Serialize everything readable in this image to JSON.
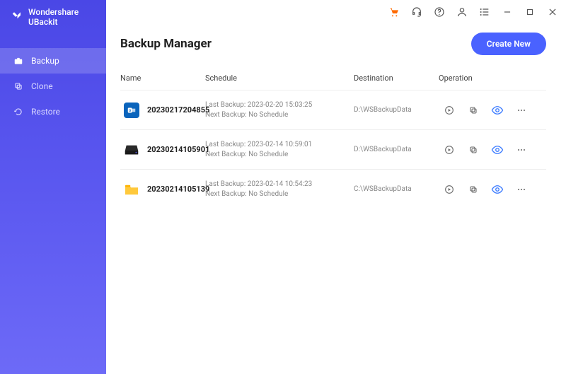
{
  "app_title": "Wondershare UBackit",
  "sidebar": {
    "items": [
      {
        "label": "Backup",
        "active": true
      },
      {
        "label": "Clone",
        "active": false
      },
      {
        "label": "Restore",
        "active": false
      }
    ]
  },
  "page": {
    "title": "Backup Manager",
    "create_button": "Create New"
  },
  "columns": {
    "name": "Name",
    "schedule": "Schedule",
    "destination": "Destination",
    "operation": "Operation"
  },
  "rows": [
    {
      "icon": "outlook",
      "name": "20230217204855",
      "last_backup": "Last Backup: 2023-02-20 15:03:25",
      "next_backup": "Next Backup: No Schedule",
      "destination": "D:\\WSBackupData"
    },
    {
      "icon": "disk",
      "name": "20230214105901",
      "last_backup": "Last Backup: 2023-02-14 10:59:01",
      "next_backup": "Next Backup: No Schedule",
      "destination": "D:\\WSBackupData"
    },
    {
      "icon": "folder",
      "name": "20230214105139",
      "last_backup": "Last Backup: 2023-02-14 10:54:23",
      "next_backup": "Next Backup: No Schedule",
      "destination": "C:\\WSBackupData"
    }
  ]
}
